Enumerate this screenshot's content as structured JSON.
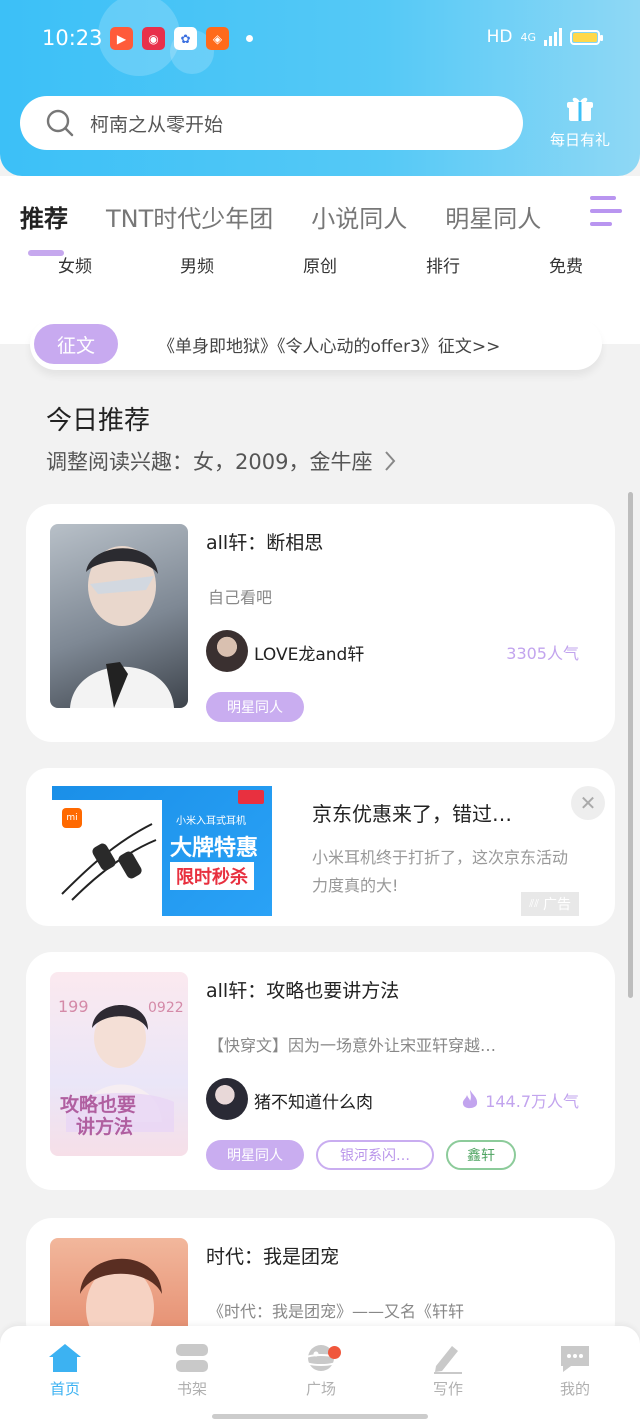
{
  "status_bar": {
    "time": "10:23",
    "network": "HD",
    "signal": "4G",
    "apps": [
      {
        "icon": "video-app-icon",
        "color": "#ff5b3a"
      },
      {
        "icon": "film-app-icon",
        "color": "#e8304b"
      },
      {
        "icon": "baidu-app-icon",
        "color": "#3b6fe0"
      },
      {
        "icon": "kuaishou-app-icon",
        "color": "#ff6a1a"
      }
    ]
  },
  "search": {
    "placeholder": "柯南之从零开始"
  },
  "daily_gift": {
    "label": "每日有礼"
  },
  "category_tabs": [
    "推荐",
    "TNT时代少年团",
    "小说同人",
    "明星同人"
  ],
  "sub_tabs": [
    "女频",
    "男频",
    "原创",
    "排行",
    "免费"
  ],
  "notice": {
    "badge": "征文",
    "text": "《单身即地狱》《令人心动的offer3》征文>>"
  },
  "today": {
    "title": "今日推荐",
    "subtitle": "调整阅读兴趣：女，2009，金牛座"
  },
  "books": [
    {
      "title": "all轩：断相思",
      "desc": "自己看吧",
      "author": "LOVE龙and轩",
      "popularity": "3305人气",
      "tags": [
        "明星同人"
      ]
    },
    {
      "title": "all轩：攻略也要讲方法",
      "desc": "【快穿文】因为一场意外让宋亚轩穿越…",
      "author": "猪不知道什么肉",
      "popularity": "144.7万人气",
      "tags": [
        "明星同人",
        "银河系闪…",
        "鑫轩"
      ],
      "cover_text": [
        "攻略也要",
        "讲方法"
      ]
    },
    {
      "title": "时代：我是团宠",
      "desc": "《时代：我是团宠》——又名《轩轩"
    }
  ],
  "ad": {
    "title": "京东优惠来了，错过…",
    "desc": "小米耳机终于打折了，这次京东活动力度真的大!",
    "label": "广告",
    "banner_line1": "小米入耳式耳机",
    "banner_line2": "大牌特惠",
    "banner_line3": "限时秒杀"
  },
  "bottom_nav": [
    "首页",
    "书架",
    "广场",
    "写作",
    "我的"
  ],
  "colors": {
    "header_blue": "#3cc0f7",
    "accent_purple": "#c9adf0",
    "active_blue": "#3cb2f2"
  }
}
